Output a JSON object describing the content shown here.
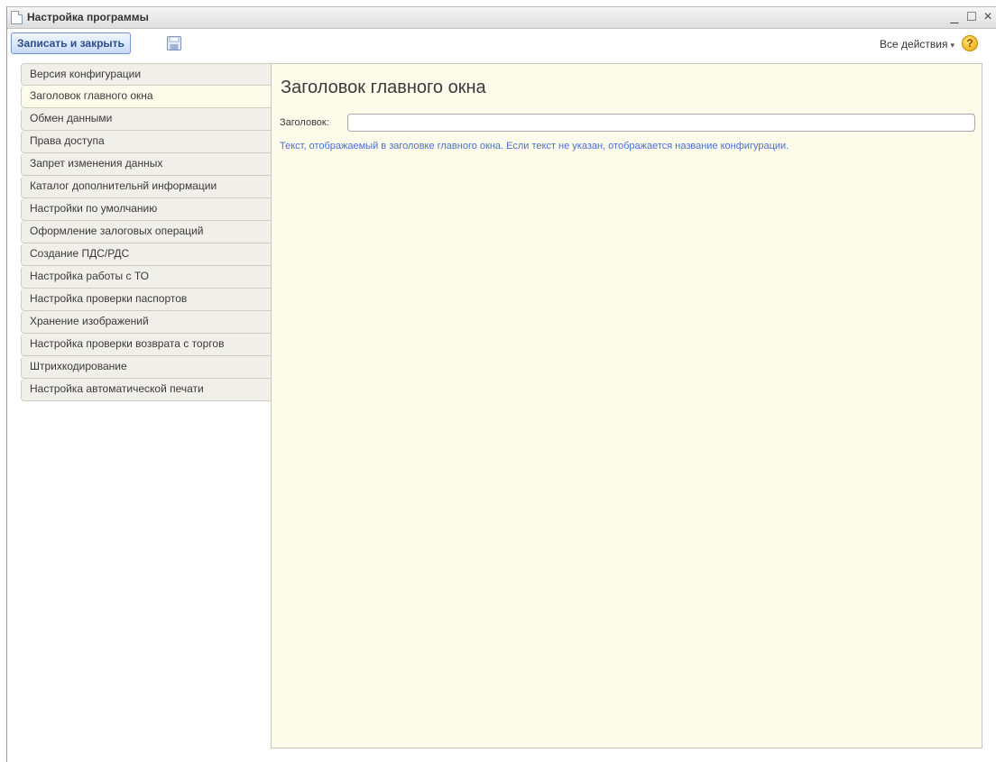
{
  "window": {
    "title": "Настройка программы",
    "controls": {
      "minimize": "_",
      "maximize": "□",
      "close": "×"
    }
  },
  "toolbar": {
    "save_close_label": "Записать и закрыть",
    "save_icon": "floppy-disk-icon",
    "all_actions_label": "Все действия",
    "all_actions_caret": "▾",
    "help_label": "?"
  },
  "sidebar": {
    "active_index": 1,
    "items": [
      {
        "label": "Версия конфигурации"
      },
      {
        "label": "Заголовок главного окна"
      },
      {
        "label": "Обмен данными"
      },
      {
        "label": "Права доступа"
      },
      {
        "label": "Запрет изменения данных"
      },
      {
        "label": "Каталог дополнительнй информации"
      },
      {
        "label": "Настройки по умолчанию"
      },
      {
        "label": "Оформление залоговых операций"
      },
      {
        "label": "Создание ПДС/РДС"
      },
      {
        "label": "Настройка работы с ТО"
      },
      {
        "label": "Настройка проверки паспортов"
      },
      {
        "label": "Хранение изображений"
      },
      {
        "label": "Настройка проверки возврата с торгов"
      },
      {
        "label": "Штрихкодирование"
      },
      {
        "label": "Настройка автоматической печати"
      }
    ]
  },
  "content": {
    "title": "Заголовок главного окна",
    "field_label": "Заголовок:",
    "field_value": "",
    "hint": "Текст, отображаемый в заголовке главного окна. Если текст не указан, отображается название конфигурации."
  },
  "colors": {
    "accent_button": "#c7dafb",
    "panel_background": "#fdfbea",
    "hint_text": "#4a6fd0"
  }
}
